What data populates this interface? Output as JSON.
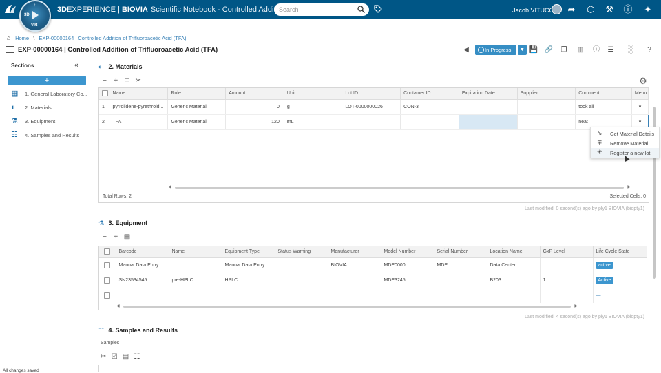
{
  "topbar": {
    "brand_bold": "3D",
    "brand_light": "EXPERIENCE | ",
    "brand_app": "BIOVIA",
    "app_subtitle": "Scientific Notebook - Controlled Additi...",
    "compass_label": "V,R",
    "search_placeholder": "Search",
    "user_name": "Jacob VITUCCI"
  },
  "breadcrumb": {
    "home": "Home",
    "separator": "\\",
    "current": "EXP-00000164 | Controlled Addition of Trifluoroacetic Acid (TFA)"
  },
  "page": {
    "title": "EXP-00000164 | Controlled Addition of Trifluoroacetic Acid (TFA)",
    "status": "In Progress"
  },
  "sidebar": {
    "heading": "Sections",
    "add_label": "+",
    "collapse_label": "«",
    "items": [
      {
        "label": "1. General Laboratory Co...",
        "icon": "notebook-icon"
      },
      {
        "label": "2. Materials",
        "icon": "materials-icon"
      },
      {
        "label": "3. Equipment",
        "icon": "microscope-icon"
      },
      {
        "label": "4. Samples and Results",
        "icon": "clipboard-icon"
      }
    ]
  },
  "materials": {
    "heading": "2. Materials",
    "columns": [
      "Name",
      "Role",
      "Amount",
      "Unit",
      "Lot ID",
      "Container ID",
      "Expiration Date",
      "Supplier",
      "Comment",
      "Menu"
    ],
    "rows": [
      {
        "idx": "1",
        "name": "pyrrolidene-pyrethroid...",
        "role": "Generic Material",
        "amount": "0",
        "unit": "g",
        "lot": "LOT-0000000026",
        "container": "CON-3",
        "expiration": "",
        "supplier": "",
        "comment": "took all",
        "menu": "▾"
      },
      {
        "idx": "2",
        "name": "TFA",
        "role": "Generic Material",
        "amount": "120",
        "unit": "mL",
        "lot": "",
        "container": "",
        "expiration": "",
        "supplier": "",
        "comment": "neat",
        "menu": "▾"
      }
    ],
    "total_rows": "Total Rows: 2",
    "selected_cells": "Selected Cells: 0",
    "last_modified": "Last modified: 0 second(s) ago by ply1 BIOVIA (biopty1)"
  },
  "context_menu": {
    "items": [
      {
        "label": "Get Material Details",
        "icon": "arrow-down-right-icon"
      },
      {
        "label": "Remove Material",
        "icon": "remove-icon"
      },
      {
        "label": "Register a new lot",
        "icon": "asterisk-icon"
      }
    ]
  },
  "equipment": {
    "heading": "3. Equipment",
    "columns": [
      "Barcode",
      "Name",
      "Equipment Type",
      "Status Warning",
      "Manufacturer",
      "Model Number",
      "Serial Number",
      "Location Name",
      "GxP Level",
      "Life Cycle State"
    ],
    "rows": [
      {
        "barcode": "Manual Data Entry",
        "name": "",
        "type": "Manual Data Entry",
        "warning": "",
        "manufacturer": "BIOVIA",
        "model": "MDE0000",
        "serial": "MDE",
        "location": "Data Center",
        "gxp": "",
        "state": "active"
      },
      {
        "barcode": "SN23534545",
        "name": "pre-HPLC",
        "type": "HPLC",
        "warning": "",
        "manufacturer": "",
        "model": "MDE3245",
        "serial": "",
        "location": "B203",
        "gxp": "1",
        "state": "Active"
      },
      {
        "barcode": "",
        "name": "",
        "type": "",
        "warning": "",
        "manufacturer": "",
        "model": "",
        "serial": "",
        "location": "",
        "gxp": "",
        "state": "—"
      }
    ],
    "last_modified": "Last modified: 4 second(s) ago by ply1 BIOVIA (biopty1)"
  },
  "samples": {
    "heading": "4. Samples and Results",
    "sub_label": "Samples"
  },
  "status_bar": {
    "text": "All changes saved"
  },
  "colors": {
    "topbar": "#005686",
    "accent": "#3c96cf",
    "link": "#3a82b7"
  }
}
